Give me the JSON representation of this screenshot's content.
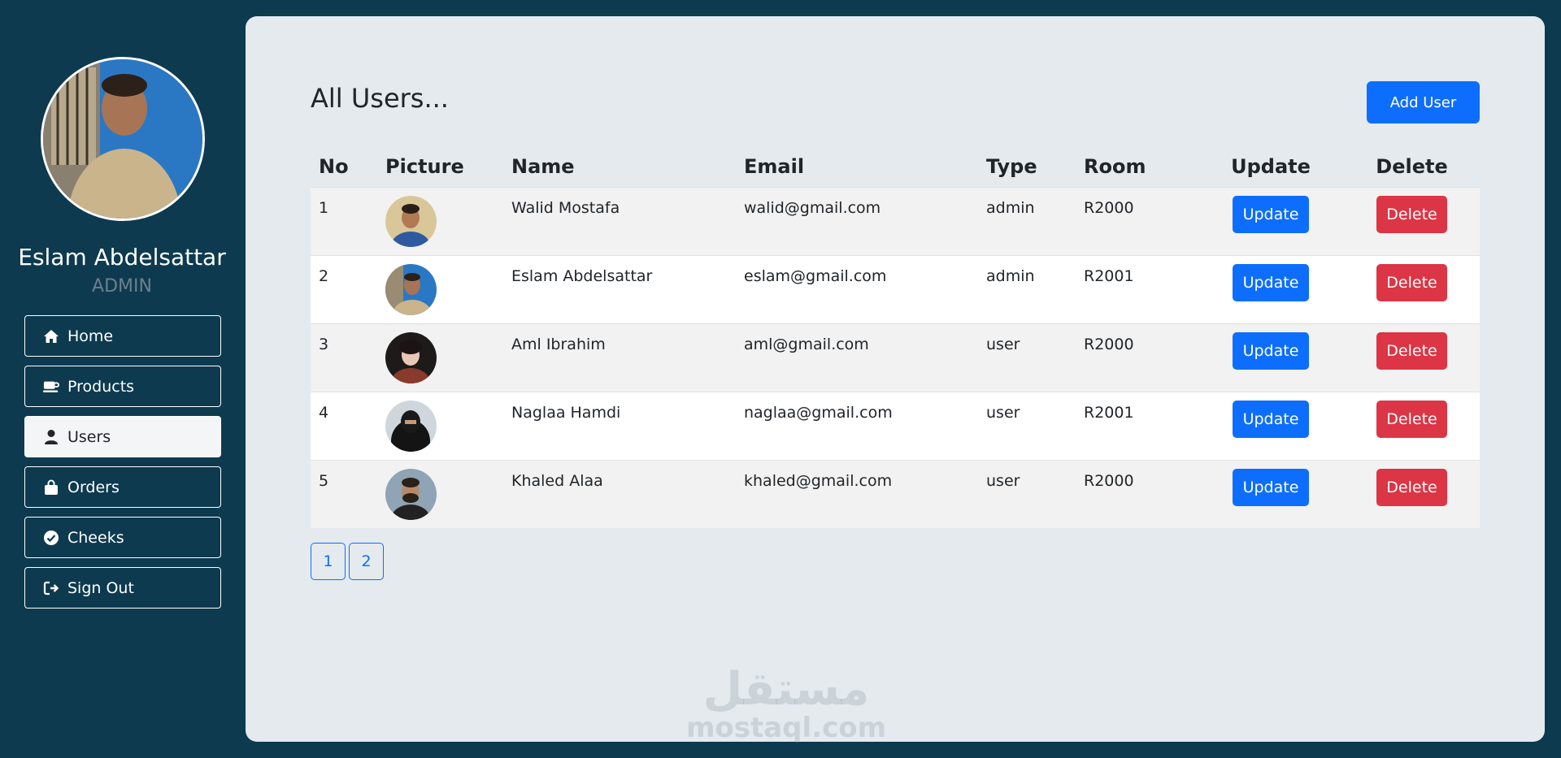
{
  "profile": {
    "name": "Eslam Abdelsattar",
    "role": "ADMIN"
  },
  "nav": {
    "items": [
      {
        "label": "Home",
        "icon": "home-icon"
      },
      {
        "label": "Products",
        "icon": "coffee-cup-icon"
      },
      {
        "label": "Users",
        "icon": "user-icon",
        "active": true
      },
      {
        "label": "Orders",
        "icon": "shopping-bag-icon"
      },
      {
        "label": "Cheeks",
        "icon": "check-circle-icon"
      },
      {
        "label": "Sign Out",
        "icon": "sign-out-icon"
      }
    ]
  },
  "page": {
    "title": "All Users...",
    "add_button": "Add User"
  },
  "table": {
    "headers": [
      "No",
      "Picture",
      "Name",
      "Email",
      "Type",
      "Room",
      "Update",
      "Delete"
    ],
    "rows": [
      {
        "no": "1",
        "name": "Walid Mostafa",
        "email": "walid@gmail.com",
        "type": "admin",
        "room": "R2000",
        "update": "Update",
        "delete": "Delete"
      },
      {
        "no": "2",
        "name": "Eslam Abdelsattar",
        "email": "eslam@gmail.com",
        "type": "admin",
        "room": "R2001",
        "update": "Update",
        "delete": "Delete"
      },
      {
        "no": "3",
        "name": "Aml Ibrahim",
        "email": "aml@gmail.com",
        "type": "user",
        "room": "R2000",
        "update": "Update",
        "delete": "Delete"
      },
      {
        "no": "4",
        "name": "Naglaa Hamdi",
        "email": "naglaa@gmail.com",
        "type": "user",
        "room": "R2001",
        "update": "Update",
        "delete": "Delete"
      },
      {
        "no": "5",
        "name": "Khaled Alaa",
        "email": "khaled@gmail.com",
        "type": "user",
        "room": "R2000",
        "update": "Update",
        "delete": "Delete"
      }
    ]
  },
  "pagination": {
    "pages": [
      "1",
      "2"
    ]
  },
  "watermark": {
    "arabic": "مستقل",
    "latin": "mostaql.com"
  },
  "colors": {
    "sidebar_bg": "#0d3a4f",
    "main_bg": "#e4eaee",
    "primary": "#0d6efd",
    "danger": "#dc3545"
  }
}
